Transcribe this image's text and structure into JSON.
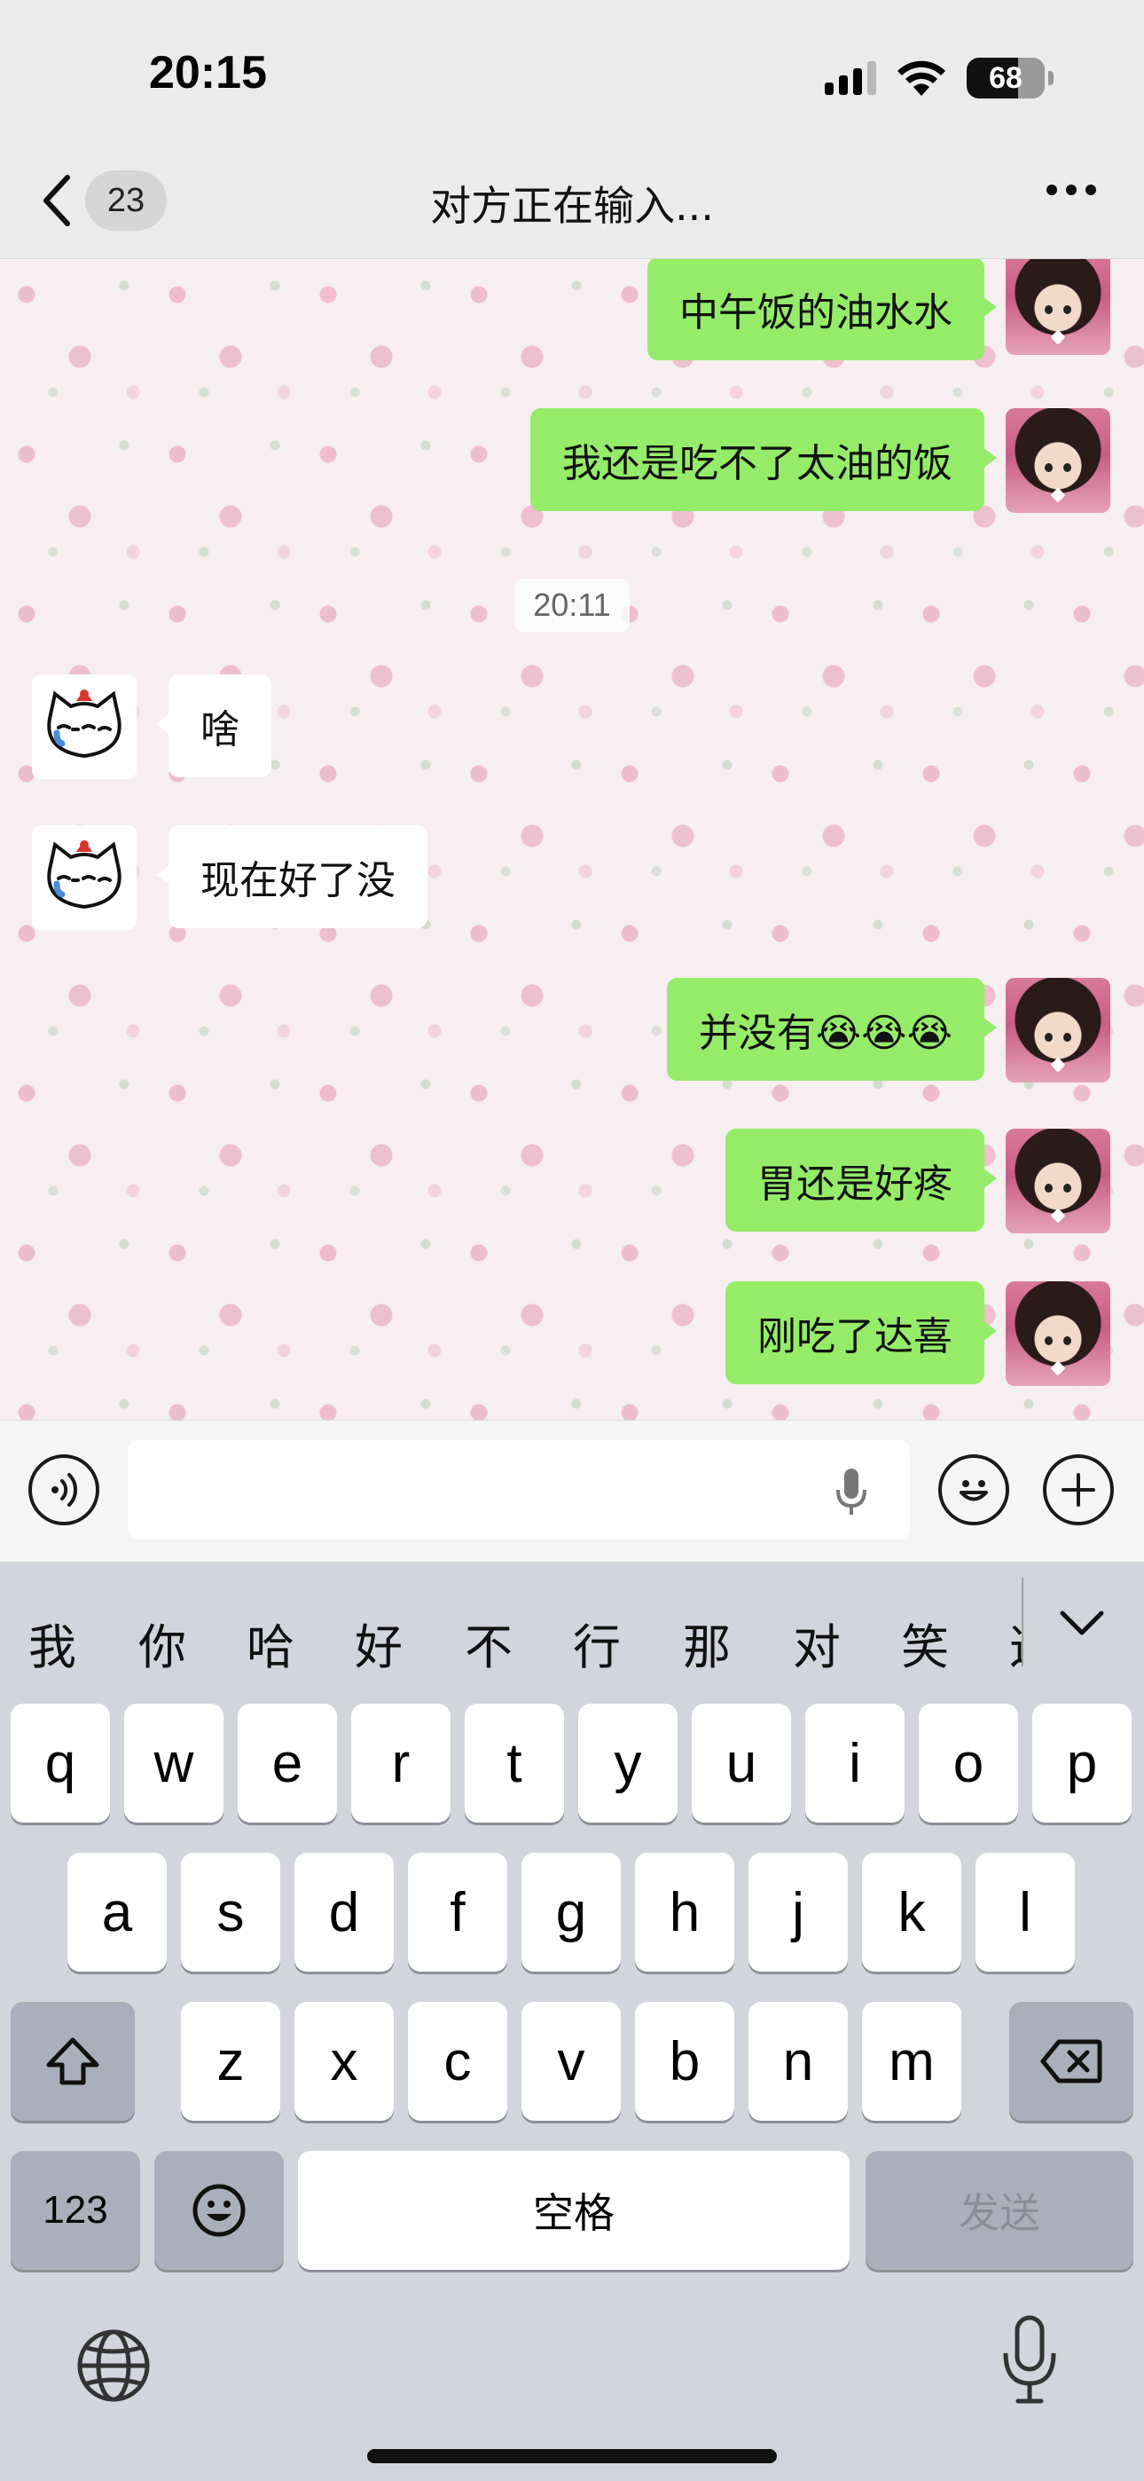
{
  "status_bar": {
    "time": "20:15",
    "battery": "68"
  },
  "header": {
    "back_count": "23",
    "title": "对方正在输入..."
  },
  "messages": [
    {
      "side": "out",
      "text": "中午饭的油水水"
    },
    {
      "side": "out",
      "text": "我还是吃不了太油的饭"
    },
    {
      "side": "in",
      "text": "啥"
    },
    {
      "side": "in",
      "text": "现在好了没"
    },
    {
      "side": "out",
      "text": "并没有😭😭😭"
    },
    {
      "side": "out",
      "text": "胃还是好疼"
    },
    {
      "side": "out",
      "text": "刚吃了达喜"
    }
  ],
  "timestamp": "20:11",
  "input_bar": {
    "value": "",
    "placeholder": ""
  },
  "keyboard": {
    "candidates": [
      "我",
      "你",
      "哈",
      "好",
      "不",
      "行",
      "那",
      "对",
      "笑",
      "这"
    ],
    "row1": [
      "q",
      "w",
      "e",
      "r",
      "t",
      "y",
      "u",
      "i",
      "o",
      "p"
    ],
    "row2": [
      "a",
      "s",
      "d",
      "f",
      "g",
      "h",
      "j",
      "k",
      "l"
    ],
    "row3": [
      "z",
      "x",
      "c",
      "v",
      "b",
      "n",
      "m"
    ],
    "numbers_key": "123",
    "space_key": "空格",
    "send_key": "发送"
  },
  "colors": {
    "outgoing_bubble": "#95ec69",
    "incoming_bubble": "#ffffff",
    "keyboard_bg": "#d3d5dc"
  }
}
